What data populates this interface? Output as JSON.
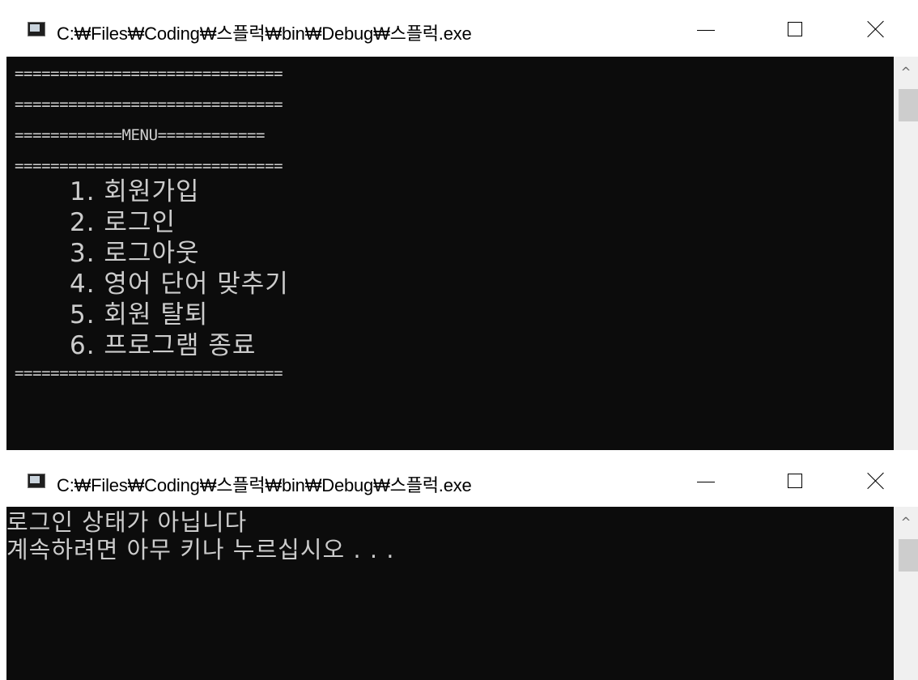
{
  "windows": [
    {
      "title": "C:₩Files₩Coding₩스플럭₩bin₩Debug₩스플럭.exe",
      "icon": "console-app-icon",
      "controls": {
        "minimize": "minimize-icon",
        "maximize": "maximize-icon",
        "close": "close-icon"
      },
      "console_lines": [
        "==============================",
        "==============================",
        "============MENU============",
        "==============================",
        "1. 회원가입",
        "2. 로그인",
        "3. 로그아웃",
        "4. 영어 단어 맞추기",
        "5. 회원 탈퇴",
        "6. 프로그램 종료",
        "=============================="
      ],
      "scrollbar": {
        "up_arrow": "^"
      }
    },
    {
      "title": "C:₩Files₩Coding₩스플럭₩bin₩Debug₩스플럭.exe",
      "icon": "console-app-icon",
      "controls": {
        "minimize": "minimize-icon",
        "maximize": "maximize-icon",
        "close": "close-icon"
      },
      "console_lines": [
        "로그인 상태가 아닙니다",
        "계속하려면 아무 키나 누르십시오 . . ."
      ],
      "scrollbar": {
        "up_arrow": "^"
      }
    }
  ],
  "colors": {
    "console_bg": "#0c0c0c",
    "console_text": "#cccccc",
    "titlebar_bg": "#ffffff",
    "scrollbar_bg": "#f0f0f0",
    "scroll_thumb": "#cdcdcd"
  }
}
